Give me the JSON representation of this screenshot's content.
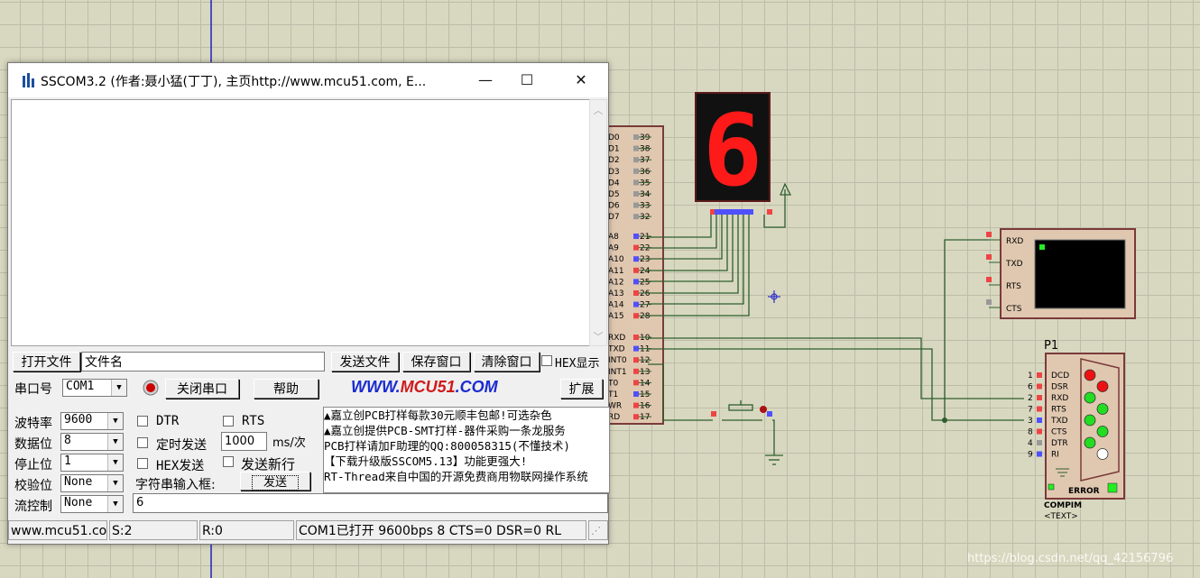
{
  "window": {
    "title": "SSCOM3.2 (作者:聂小猛(丁丁), 主页http://www.mcu51.com,  E...",
    "min_glyph": "—",
    "max_glyph": "☐",
    "close_glyph": "✕"
  },
  "toolbar": {
    "open_file": "打开文件",
    "file_name": "文件名",
    "send_file": "发送文件",
    "save_window": "保存窗口",
    "clear_window": "清除窗口",
    "hex_display": "HEX显示"
  },
  "port_row": {
    "port_label": "串口号",
    "port_value": "COM1",
    "close_port": "关闭串口",
    "help": "帮助",
    "logo_www": "WWW.",
    "logo_mcu": "MCU51",
    "logo_com": ".COM",
    "expand": "扩展"
  },
  "settings": {
    "baud_label": "波特率",
    "baud_value": "9600",
    "databits_label": "数据位",
    "databits_value": "8",
    "stopbits_label": "停止位",
    "stopbits_value": "1",
    "parity_label": "校验位",
    "parity_value": "None",
    "flow_label": "流控制",
    "flow_value": "None"
  },
  "options": {
    "dtr": "DTR",
    "rts": "RTS",
    "timed_send": "定时发送",
    "interval": "1000",
    "interval_unit": "ms/次",
    "hex_send": "HEX发送",
    "send_newline": "发送新行",
    "input_label": "字符串输入框:",
    "send_button": "发送",
    "input_value": "6"
  },
  "ads": [
    "▲嘉立创PCB打样每款30元顺丰包邮!可选杂色",
    "▲嘉立创提供PCB-SMT打样-器件采购一条龙服务",
    "PCB打样请加F助理的QQ:800058315(不懂技术)",
    "【下载升级版SSCOM5.13】功能更强大!",
    "RT-Thread来自中国的开源免费商用物联网操作系统"
  ],
  "statusbar": {
    "url": "www.mcu51.com",
    "sent": "S:2",
    "recv": "R:0",
    "port_status": "COM1已打开  9600bps  8  CTS=0 DSR=0 RL"
  },
  "schematic": {
    "display_digit": "6",
    "mcu_port0_labels": [
      "D0",
      "D1",
      "D2",
      "D3",
      "D4",
      "D5",
      "D6",
      "D7"
    ],
    "mcu_port0_pins": [
      "39",
      "38",
      "37",
      "36",
      "35",
      "34",
      "33",
      "32"
    ],
    "mcu_port2_labels": [
      "A8",
      "A9",
      "A10",
      "A11",
      "A12",
      "A13",
      "A14",
      "A15"
    ],
    "mcu_port2_pins": [
      "21",
      "22",
      "23",
      "24",
      "25",
      "26",
      "27",
      "28"
    ],
    "mcu_port3_labels": [
      "RXD",
      "TXD",
      "INT0",
      "INT1",
      "T0",
      "T1",
      "WR",
      "RD"
    ],
    "mcu_port3_pins": [
      "10",
      "11",
      "12",
      "13",
      "14",
      "15",
      "16",
      "17"
    ],
    "terminal_pins": [
      "RXD",
      "TXD",
      "RTS",
      "CTS"
    ],
    "connector_ref": "P1",
    "connector_pins": [
      "DCD",
      "DSR",
      "RXD",
      "RTS",
      "TXD",
      "CTS",
      "DTR",
      "RI"
    ],
    "connector_nums": [
      "1",
      "6",
      "2",
      "7",
      "3",
      "8",
      "4",
      "9"
    ],
    "connector_error": "ERROR",
    "connector_name": "COMPIM",
    "connector_text": "<TEXT>"
  },
  "colors": {
    "wire": "#2e5e2e",
    "segment_on": "#ff1a1a",
    "led_green": "#22dd22",
    "led_red": "#ee1111",
    "logo_blue": "#1a2bd0",
    "logo_red": "#d01a1a"
  },
  "watermark": "https://blog.csdn.net/qq_42156796"
}
